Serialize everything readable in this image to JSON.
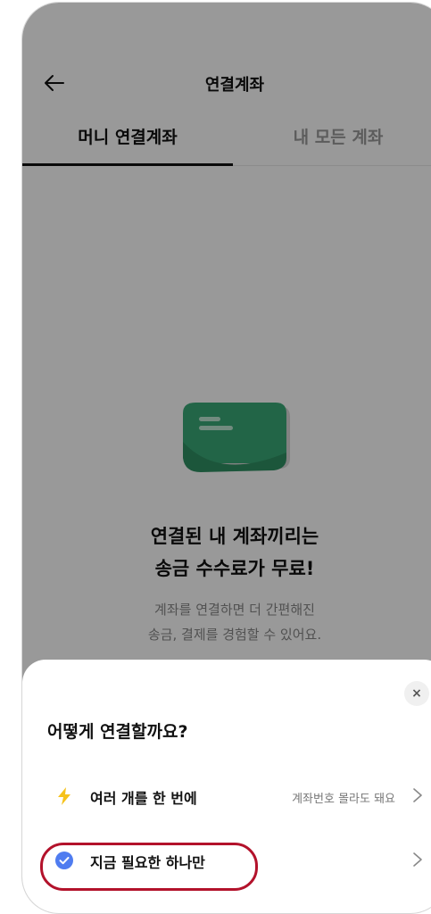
{
  "header": {
    "title": "연결계좌"
  },
  "tabs": [
    {
      "label": "머니 연결계좌"
    },
    {
      "label": "내 모든 계좌"
    }
  ],
  "empty": {
    "title_line1": "연결된 내 계좌끼리는",
    "title_line2": "송금 수수료가 무료!",
    "desc_line1": "계좌를 연결하면 더 간편해진",
    "desc_line2": "송금, 결제를 경험할 수 있어요."
  },
  "sheet": {
    "close_label": "×",
    "title": "어떻게 연결할까요?",
    "options": [
      {
        "icon": "lightning-icon",
        "label": "여러 개를 한 번에",
        "hint": "계좌번호 몰라도 돼요"
      },
      {
        "icon": "check-circle-icon",
        "label": "지금 필요한 하나만",
        "hint": ""
      }
    ]
  },
  "colors": {
    "accent_blue": "#4f7cf0",
    "lightning_yellow": "#f6c21b",
    "highlight_red": "#b3122b",
    "wallet_green": "#3aa877"
  }
}
